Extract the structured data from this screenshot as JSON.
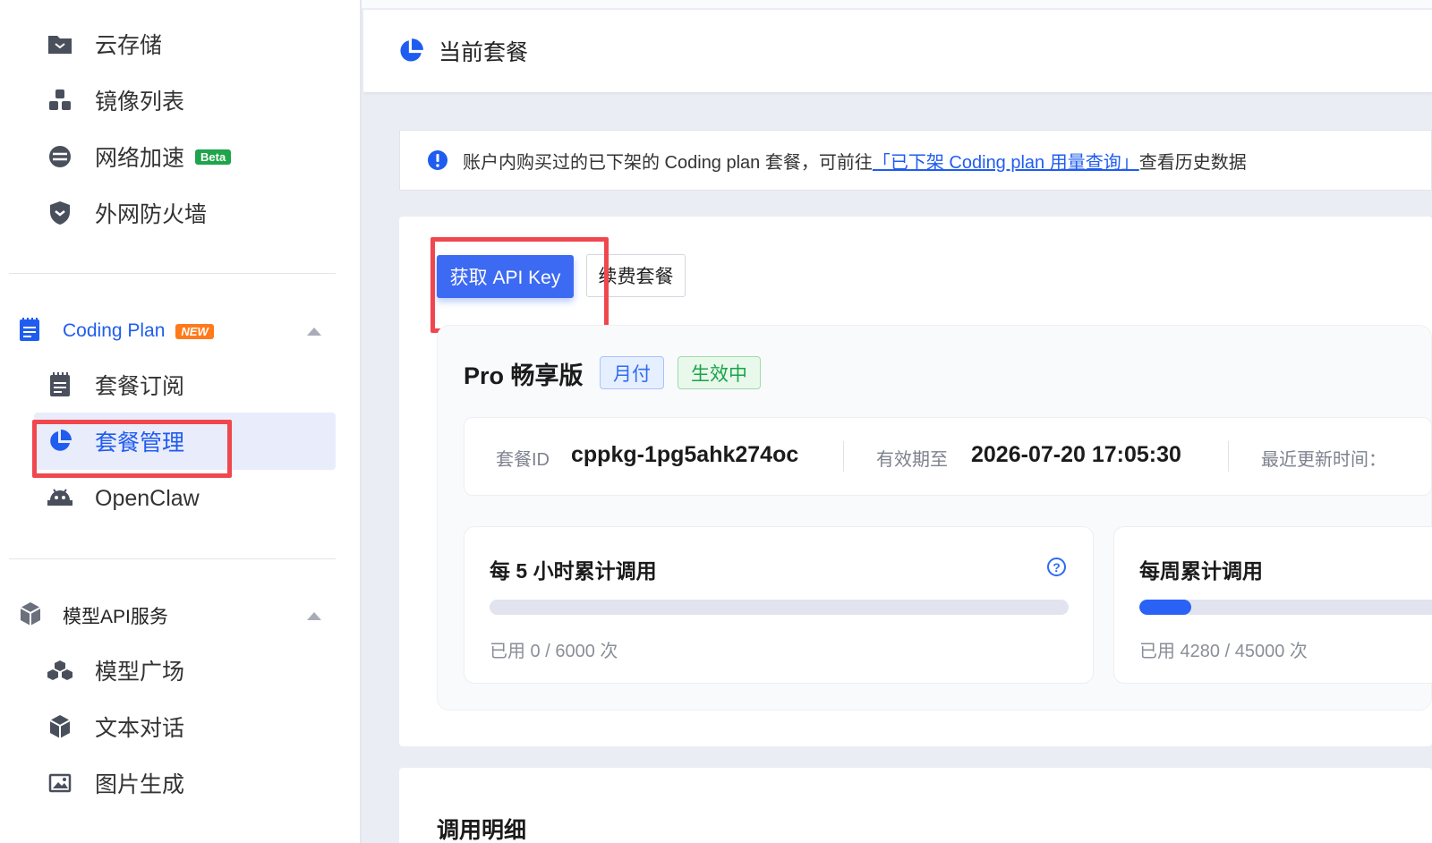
{
  "sidebar": {
    "items_top": [
      {
        "label": "云存储",
        "icon": "folder-icon"
      },
      {
        "label": "镜像列表",
        "icon": "cubes-icon"
      },
      {
        "label": "网络加速",
        "icon": "network-icon",
        "badge": "Beta"
      },
      {
        "label": "外网防火墙",
        "icon": "shield-icon"
      }
    ],
    "coding_plan": {
      "label": "Coding Plan",
      "badge": "NEW",
      "items": [
        {
          "label": "套餐订阅",
          "icon": "notepad-icon"
        },
        {
          "label": "套餐管理",
          "icon": "pie-chart-icon",
          "active": true
        },
        {
          "label": "OpenClaw",
          "icon": "android-icon"
        }
      ]
    },
    "model_api": {
      "label": "模型API服务",
      "items": [
        {
          "label": "模型广场",
          "icon": "cubes-cluster-icon"
        },
        {
          "label": "文本对话",
          "icon": "box-icon"
        },
        {
          "label": "图片生成",
          "icon": "image-icon"
        }
      ]
    }
  },
  "header": {
    "title": "当前套餐",
    "icon": "pie-chart-icon"
  },
  "notice": {
    "text_before": "账户内购买过的已下架的 Coding plan 套餐，可前往",
    "link": "「已下架 Coding plan 用量查询」",
    "text_after": " 查看历史数据"
  },
  "actions": {
    "primary": "获取 API Key",
    "secondary": "续费套餐"
  },
  "plan": {
    "name": "Pro 畅享版",
    "tag_billing": "月付",
    "tag_status": "生效中",
    "id_label": "套餐ID",
    "id_value": "cppkg-1pg5ahk274oc",
    "expiry_label": "有效期至",
    "expiry_value": "2026-07-20 17:05:30",
    "updated_label": "最近更新时间："
  },
  "usage": [
    {
      "title": "每 5 小时累计调用",
      "used_text": "已用 0 / 6000 次",
      "fraction": 0.0
    },
    {
      "title": "每周累计调用",
      "used_text": "已用 4280 / 45000 次",
      "fraction": 0.095
    }
  ],
  "details_title": "调用明细",
  "colors": {
    "accent": "#1f5cf0",
    "highlight": "#f0474f",
    "success": "#19a34a"
  }
}
